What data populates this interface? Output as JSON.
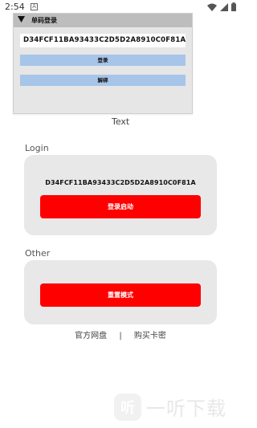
{
  "statusbar": {
    "time": "2:54",
    "notif_letter": "A"
  },
  "panel": {
    "title": "单码登录",
    "code_value": "D34FCF11BA93433C2D5D2A8910C0F81A",
    "login_button": "登录",
    "unbind_button": "解绑",
    "caption": "Text"
  },
  "login_section": {
    "label": "Login",
    "code_text": "D34FCF11BA93433C2D5D2A8910C0F81A",
    "button": "登录启动"
  },
  "other_section": {
    "label": "Other",
    "button": "重置模式"
  },
  "links": {
    "left": "官方网盘",
    "separator": "|",
    "right": "购买卡密"
  },
  "watermark": {
    "logo_text": "听",
    "text": "一听下载"
  },
  "colors": {
    "primary_red": "#ff0000",
    "panel_button_blue": "#a7c5e9",
    "card_bg": "#e8e8e8"
  }
}
